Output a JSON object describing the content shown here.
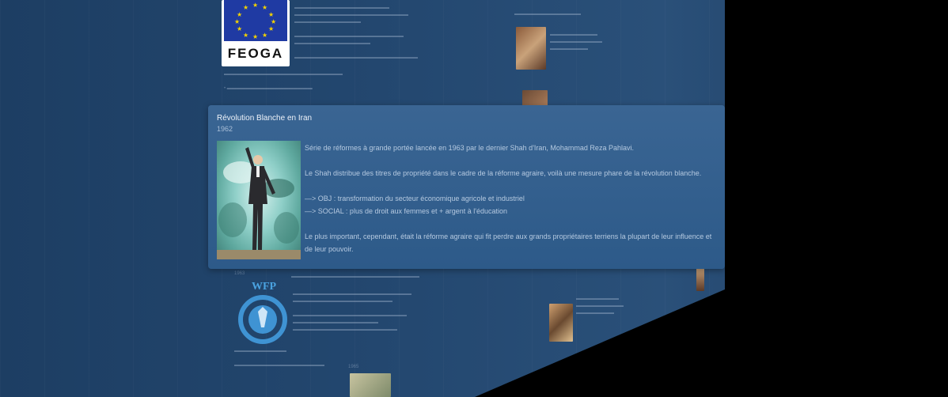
{
  "background": {
    "feoga_logo_text": "FEOGA",
    "wfp_logo_text": "WFP",
    "year_1963": "1963",
    "year_1965": "1965"
  },
  "popup": {
    "title": "Révolution Blanche en Iran",
    "year": "1962",
    "paragraphs": [
      "Série de réformes à grande portée lancée en 1963 par le dernier Shah d'Iran, Mohammad Reza Pahlavi.",
      "Le Shah distribue des titres de propriété dans le cadre de la réforme agraire, voilà une mesure phare de la révolution blanche.",
      "—> OBJ : transformation du secteur économique agricole et industriel",
      "—> SOCIAL : plus de droit aux femmes et + argent à l'éducation",
      "Le plus important, cependant, était la réforme agraire qui fit perdre aux grands propriétaires terriens la plupart de leur influence et de leur pouvoir."
    ]
  },
  "colors": {
    "wall": "#23476f",
    "card": "#33608f",
    "text": "#b5c9e0"
  }
}
